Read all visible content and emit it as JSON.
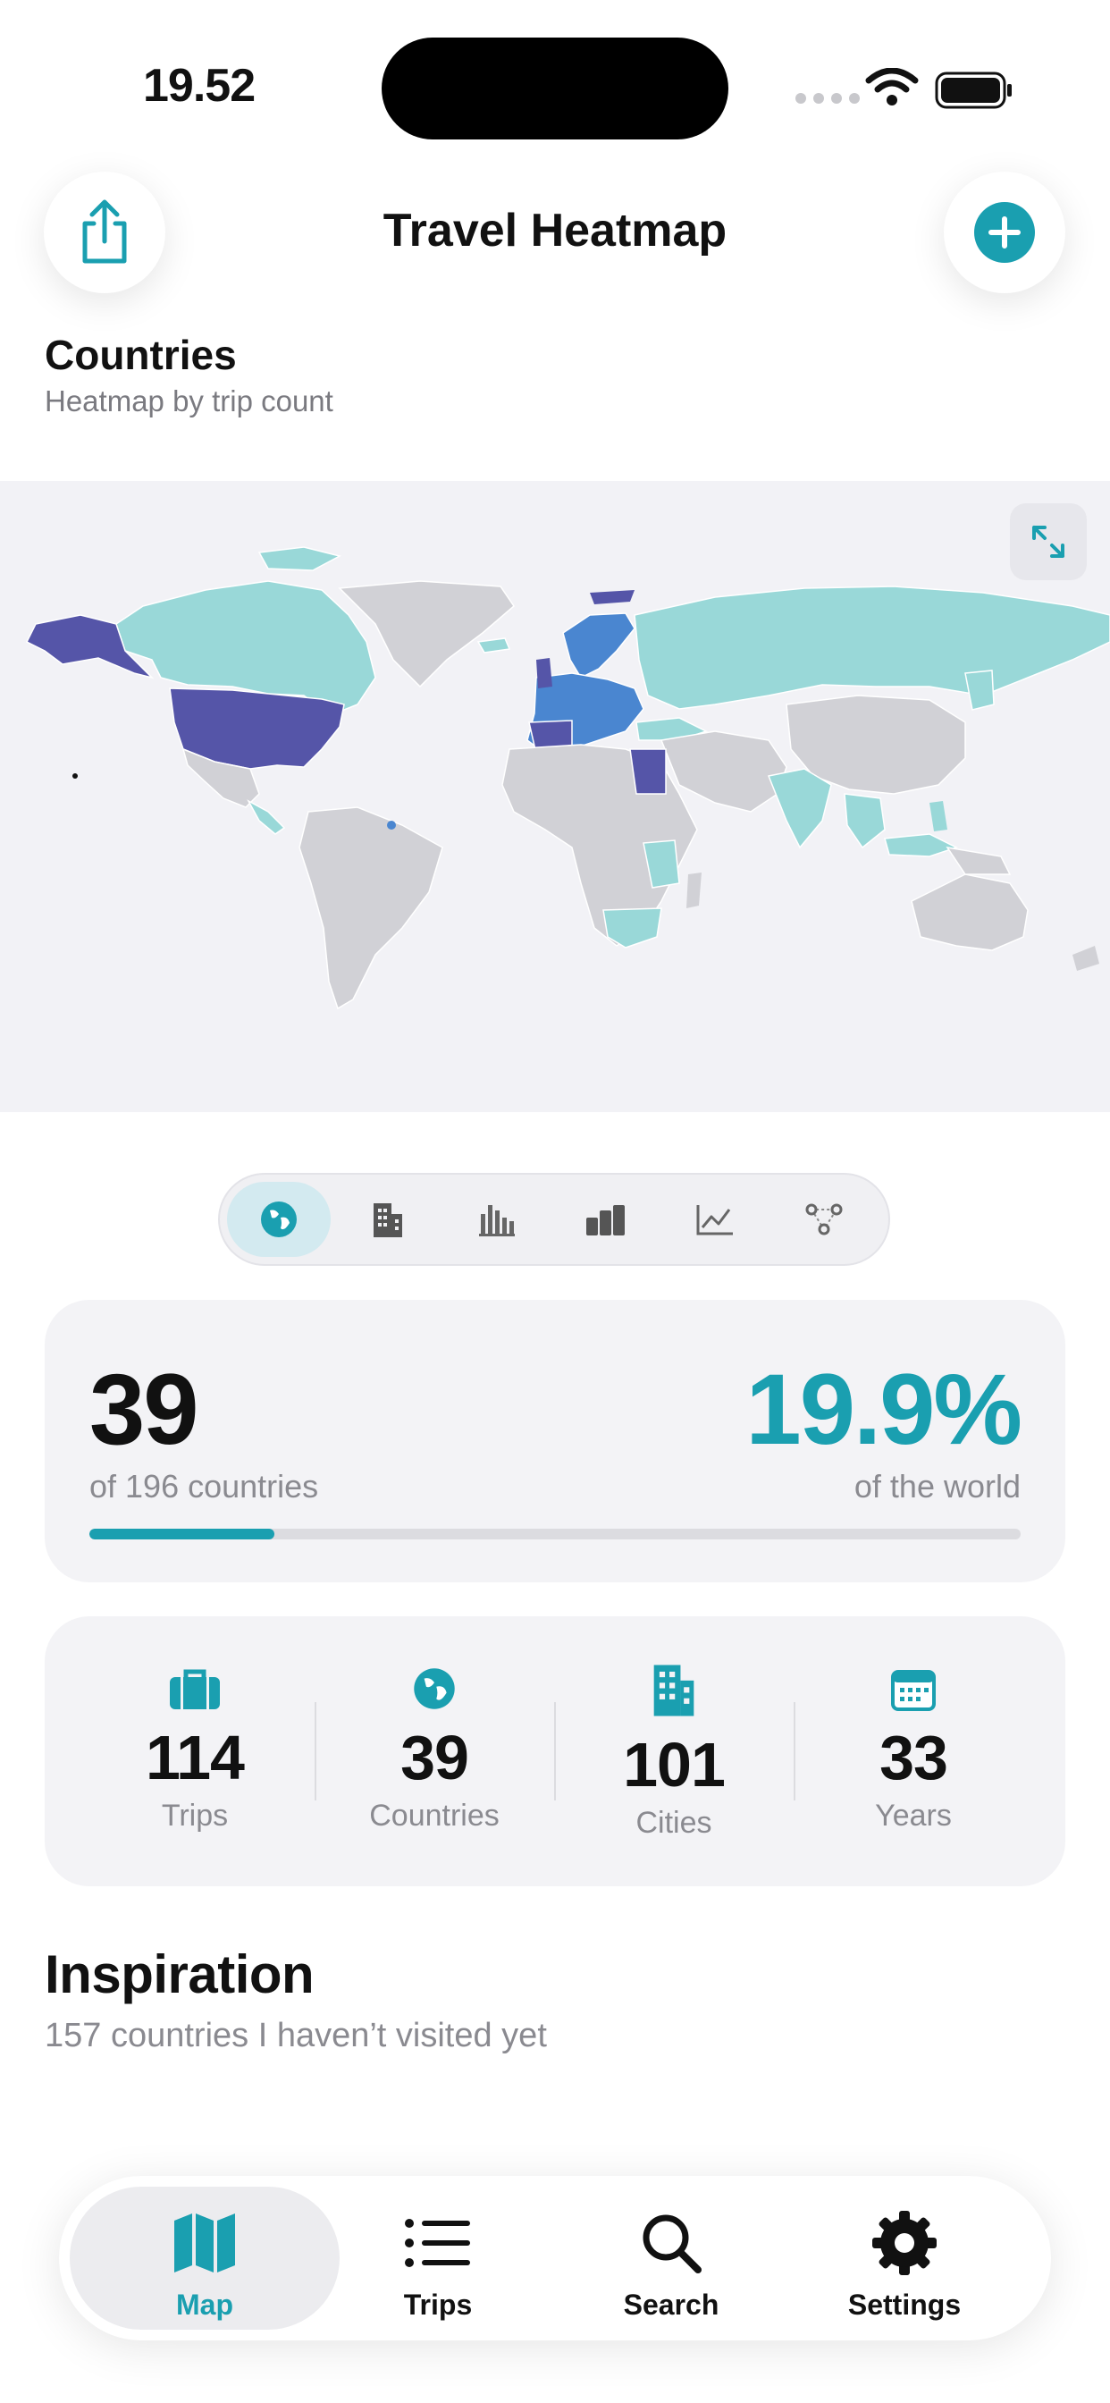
{
  "status_bar": {
    "time": "19.52"
  },
  "header": {
    "title": "Travel Heatmap"
  },
  "section": {
    "title": "Countries",
    "subtitle": "Heatmap by trip count"
  },
  "colors": {
    "accent": "#1a9fb0",
    "map_unvisited": "#d1d1d6",
    "map_low": "#99d8d8",
    "map_mid": "#4a86d0",
    "map_high": "#5555a8"
  },
  "segments": [
    {
      "icon": "globe-icon",
      "active": true
    },
    {
      "icon": "buildings-icon",
      "active": false
    },
    {
      "icon": "bar-chart-icon",
      "active": false
    },
    {
      "icon": "column-chart-icon",
      "active": false
    },
    {
      "icon": "line-chart-icon",
      "active": false
    },
    {
      "icon": "network-icon",
      "active": false
    }
  ],
  "stats": {
    "count": "39",
    "count_label": "of 196 countries",
    "percent": "19.9%",
    "percent_label": "of the world",
    "progress": 0.199
  },
  "summary": [
    {
      "icon": "suitcase-icon",
      "value": "114",
      "label": "Trips"
    },
    {
      "icon": "globe-icon",
      "value": "39",
      "label": "Countries"
    },
    {
      "icon": "building-icon",
      "value": "101",
      "label": "Cities"
    },
    {
      "icon": "calendar-icon",
      "value": "33",
      "label": "Years"
    }
  ],
  "inspiration": {
    "title": "Inspiration",
    "subtitle": "157 countries I haven’t visited yet"
  },
  "tabs": [
    {
      "label": "Map",
      "icon": "map-icon",
      "active": true
    },
    {
      "label": "Trips",
      "icon": "list-icon",
      "active": false
    },
    {
      "label": "Search",
      "icon": "magnifier-icon",
      "active": false
    },
    {
      "label": "Settings",
      "icon": "gear-icon",
      "active": false
    }
  ]
}
